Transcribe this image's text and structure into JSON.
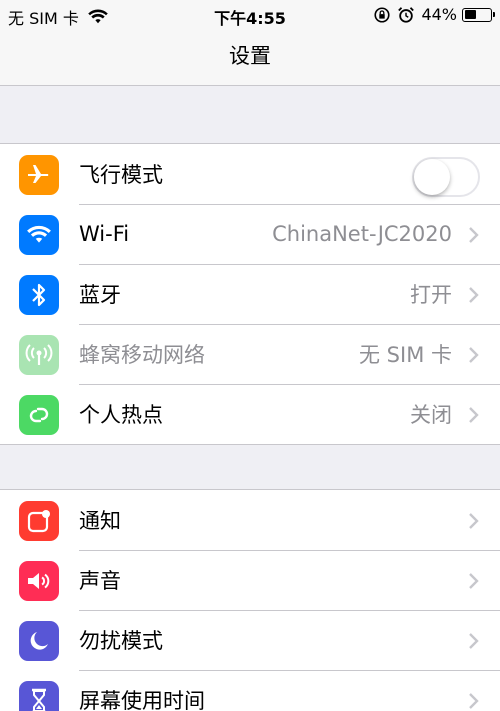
{
  "status_bar": {
    "carrier": "无 SIM 卡",
    "time": "下午4:55",
    "battery_percent": "44%",
    "battery_level": 0.44
  },
  "nav": {
    "title": "设置"
  },
  "group1": [
    {
      "label": "飞行模式",
      "icon": "airplane-icon",
      "color": "#ff9500",
      "toggle": false
    },
    {
      "label": "Wi-Fi",
      "icon": "wifi-icon",
      "color": "#007aff",
      "value": "ChinaNet-JC2020"
    },
    {
      "label": "蓝牙",
      "icon": "bluetooth-icon",
      "color": "#007aff",
      "value": "打开"
    },
    {
      "label": "蜂窝移动网络",
      "icon": "cellular-icon",
      "color": "#a9e4b2",
      "value": "无 SIM 卡",
      "disabled": true
    },
    {
      "label": "个人热点",
      "icon": "hotspot-icon",
      "color": "#4cd964",
      "value": "关闭"
    }
  ],
  "group2": [
    {
      "label": "通知",
      "icon": "notifications-icon",
      "color": "#ff3b30"
    },
    {
      "label": "声音",
      "icon": "sounds-icon",
      "color": "#ff2d55"
    },
    {
      "label": "勿扰模式",
      "icon": "moon-icon",
      "color": "#5856d6"
    },
    {
      "label": "屏幕使用时间",
      "icon": "hourglass-icon",
      "color": "#5856d6"
    }
  ]
}
